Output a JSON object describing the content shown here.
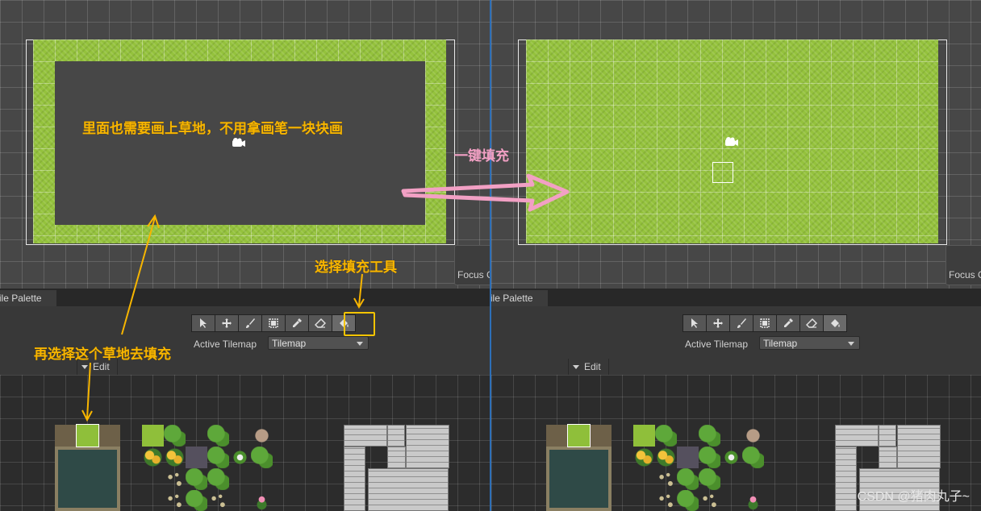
{
  "annotations": {
    "inner_note": "里面也需要画上草地，不用拿画笔一块块画",
    "fill_tool_note": "选择填充工具",
    "select_grass_note": "再选择这个草地去填充",
    "one_click_fill": "一键填充"
  },
  "left": {
    "scene": {
      "focus_label": "Focus G"
    },
    "tile_palette": {
      "tab_label": "Tile Palette",
      "active_tilemap_label": "Active Tilemap",
      "tilemap_value": "Tilemap",
      "edit_label": "Edit"
    }
  },
  "right": {
    "scene": {
      "focus_label": "Focus G"
    },
    "tile_palette": {
      "tab_label": "Tile Palette",
      "active_tilemap_label": "Active Tilemap",
      "tilemap_value": "Tilemap",
      "edit_label": "Edit"
    }
  },
  "tools": [
    {
      "name": "select-tool",
      "icon": "arrow-icon"
    },
    {
      "name": "move-tool",
      "icon": "move-icon"
    },
    {
      "name": "paint-brush-tool",
      "icon": "brush-icon"
    },
    {
      "name": "box-fill-tool",
      "icon": "box-fill-icon"
    },
    {
      "name": "picker-tool",
      "icon": "eyedropper-icon"
    },
    {
      "name": "eraser-tool",
      "icon": "eraser-icon"
    },
    {
      "name": "fill-tool",
      "icon": "paint-bucket-icon",
      "selected": true
    }
  ],
  "colors": {
    "annotation": "#f7b500",
    "arrow_pink": "#f2a0c4",
    "grass": "#94c23c",
    "divider": "#2d6fb8"
  },
  "watermark": "CSDN @猪肉丸子~"
}
